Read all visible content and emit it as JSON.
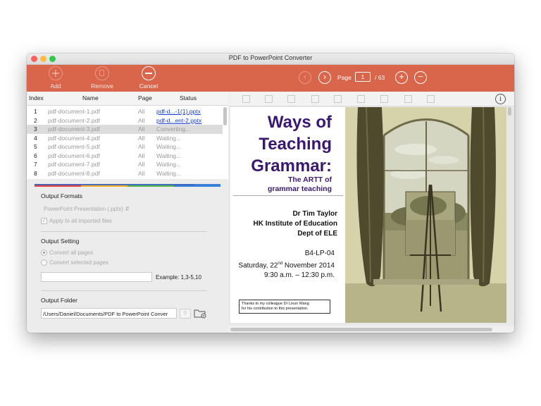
{
  "window": {
    "title": "PDF to PowerPoint Converter",
    "traffic_colors": [
      "#fc605c",
      "#fdbc40",
      "#34c84a"
    ]
  },
  "toolbar": {
    "accent": "#d9654b",
    "add_label": "Add",
    "remove_label": "Remove",
    "cancel_label": "Cancel",
    "page_label": "Page",
    "current_page": "1",
    "total_pages": "/ 63"
  },
  "file_table": {
    "headers": [
      "Index",
      "Name",
      "Page",
      "Status"
    ],
    "rows": [
      {
        "index": "1",
        "name": "pdf-document-1.pdf",
        "page": "All",
        "status": "pdf-d...-1(1).pptx"
      },
      {
        "index": "2",
        "name": "pdf-document-2.pdf",
        "page": "All",
        "status": "pdf-d...ent-2.pptx"
      },
      {
        "index": "3",
        "name": "pdf-document-3.pdf",
        "page": "All",
        "status": "Converting..."
      },
      {
        "index": "4",
        "name": "pdf-document-4.pdf",
        "page": "All",
        "status": "Waiting..."
      },
      {
        "index": "5",
        "name": "pdf-document-5.pdf",
        "page": "All",
        "status": "Waiting..."
      },
      {
        "index": "6",
        "name": "pdf-document-6.pdf",
        "page": "All",
        "status": "Waiting..."
      },
      {
        "index": "7",
        "name": "pdf-document-7.pdf",
        "page": "All",
        "status": "Waiting..."
      },
      {
        "index": "8",
        "name": "pdf-document-8.pdf",
        "page": "All",
        "status": "Waiting..."
      }
    ]
  },
  "settings": {
    "output_formats_label": "Output Formats",
    "format_value": "PowerPoint Presentation (.pptx)",
    "apply_all_label": "Apply to all imported files",
    "output_setting_label": "Output Setting",
    "convert_all_label": "Convert all pages",
    "convert_selected_label": "Convert selected pages",
    "pages_example": "Example: 1,3-5,10",
    "output_folder_label": "Output Folder",
    "output_folder_path": "/Users/Daniel/Documents/PDF to PowerPoint Conver"
  },
  "preview": {
    "slide_title_lines": [
      "Ways of",
      "Teaching",
      "Grammar:"
    ],
    "slide_subtitle_lines": [
      "The ARTT of",
      "grammar teaching"
    ],
    "author_lines": [
      "Dr Tim Taylor",
      "HK Institute of Education",
      "Dept of ELE"
    ],
    "code": "B4-LP-04",
    "date_before_sup": "Saturday, 22",
    "date_sup": "nd",
    "date_after_sup": " November 2014",
    "time": "9:30 a.m. – 12:30 p.m.",
    "thanks_lines": [
      "Thanks to my colleague Dr Lixun Wang",
      "for his contribution to this presentation."
    ],
    "info_icon": "i"
  }
}
